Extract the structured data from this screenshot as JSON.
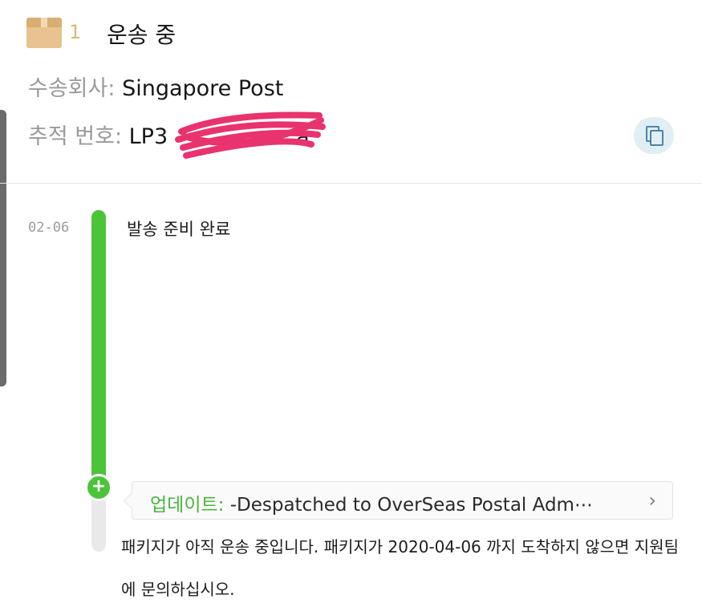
{
  "header": {
    "package_count": "1",
    "status_title": "운송 중"
  },
  "shipment": {
    "carrier_label": "수송회사:",
    "carrier_value": "Singapore Post",
    "tracking_label": "추적 번호:",
    "tracking_value": "LP3",
    "tracking_value_tail": "a"
  },
  "icons": {
    "package": "package-box-icon",
    "copy": "copy-icon",
    "plus": "plus-icon",
    "chevron": "chevron-right-icon"
  },
  "colors": {
    "accent_green": "#4cc43a",
    "copy_button_bg": "#e1eef4",
    "redaction": "#e8336f"
  },
  "timeline": {
    "events": [
      {
        "date": "02-06",
        "title": "발송 준비 완료"
      }
    ],
    "update": {
      "label": "업데이트:",
      "text": "-Despatched to OverSeas Postal Adm⋯",
      "chevron": "›"
    },
    "plus_glyph": "+",
    "note": "패키지가 아직 운송 중입니다. 패키지가 2020-04-06 까지 도착하지 않으면 지원팀에 문의하십시오."
  }
}
